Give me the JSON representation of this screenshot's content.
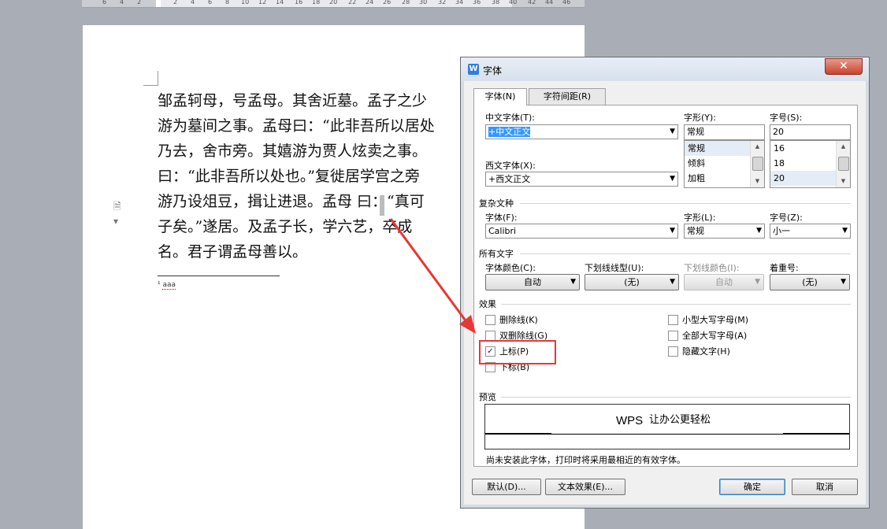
{
  "ruler": {
    "ticks": [
      "6",
      "4",
      "2",
      "2",
      "4",
      "6",
      "8",
      "10",
      "12",
      "14",
      "16",
      "18",
      "20",
      "22",
      "24",
      "26",
      "28",
      "30",
      "32",
      "34",
      "36",
      "38",
      "40",
      "42",
      "44",
      "46"
    ]
  },
  "document": {
    "lines": [
      "邹孟轲母，号孟母。其舍近墓。孟子之少",
      "游为墓间之事。孟母曰：“此非吾所以居处",
      "乃去，舍市旁。其嬉游为贾人炫卖之事。",
      "曰：“此非吾所以处也。”复徙居学宫之旁",
      "游乃设俎豆，揖让进退。孟母 曰：“真可",
      "子矣。”遂居。及孟子长，学六艺，卒成",
      "名。君子谓孟母善以。"
    ],
    "footnote": "aaa"
  },
  "dialog": {
    "title": "字体",
    "logo": "W",
    "close": "✕",
    "tabs": [
      {
        "label": "字体(N)"
      },
      {
        "label": "字符间距(R)"
      }
    ],
    "chinese_font": {
      "label": "中文字体(T):",
      "value": "+中文正文"
    },
    "western_font": {
      "label": "西文字体(X):",
      "value": "+西文正文"
    },
    "style": {
      "label": "字形(Y):",
      "value": "常规",
      "options": [
        "常规",
        "倾斜",
        "加粗"
      ]
    },
    "size": {
      "label": "字号(S):",
      "value": "20",
      "options": [
        "16",
        "18",
        "20"
      ]
    },
    "complex": {
      "section": "复杂文种",
      "font_label": "字体(F):",
      "font_value": "Calibri",
      "style_label": "字形(L):",
      "style_value": "常规",
      "size_label": "字号(Z):",
      "size_value": "小一"
    },
    "all_text": {
      "section": "所有文字",
      "color_label": "字体颜色(C):",
      "color_value": "自动",
      "underline_label": "下划线线型(U):",
      "underline_value": "(无)",
      "ucolor_label": "下划线颜色(I):",
      "ucolor_value": "自动",
      "emphasis_label": "着重号:",
      "emphasis_value": "(无)"
    },
    "effects": {
      "section": "效果",
      "left": [
        {
          "label": "删除线(K)",
          "checked": false
        },
        {
          "label": "双删除线(G)",
          "checked": false
        },
        {
          "label": "上标(P)",
          "checked": true
        },
        {
          "label": "下标(B)",
          "checked": false
        }
      ],
      "right": [
        {
          "label": "小型大写字母(M)",
          "checked": false
        },
        {
          "label": "全部大写字母(A)",
          "checked": false
        },
        {
          "label": "隐藏文字(H)",
          "checked": false
        }
      ]
    },
    "preview": {
      "section": "预览",
      "text_wps": "WPS",
      "text_cn": "让办公更轻松",
      "note": "尚未安装此字体，打印时将采用最相近的有效字体。"
    },
    "buttons": {
      "default": "默认(D)...",
      "text_effect": "文本效果(E)...",
      "ok": "确定",
      "cancel": "取消"
    }
  },
  "colors": {
    "highlight": "#e53935",
    "accent": "#3399ff"
  }
}
